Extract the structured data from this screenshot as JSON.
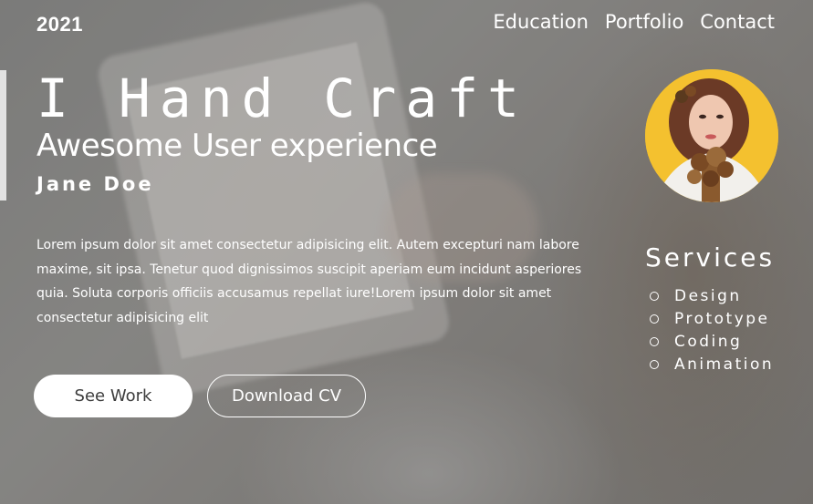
{
  "header": {
    "year": "2021",
    "nav": [
      "Education",
      "Portfolio",
      "Contact"
    ]
  },
  "hero": {
    "headline": "I Hand Craft",
    "subheadline": "Awesome User experience",
    "name": "Jane Doe",
    "bio": "Lorem ipsum dolor sit amet consectetur adipisicing elit. Autem excepturi nam labore maxime, sit ipsa. Tenetur quod dignissimos suscipit aperiam eum incidunt asperiores quia. Soluta corporis officiis accusamus repellat iure!Lorem ipsum dolor sit amet consectetur adipisicing elit"
  },
  "buttons": {
    "primary": "See Work",
    "secondary": "Download CV"
  },
  "services": {
    "title": "Services",
    "items": [
      "Design",
      "Prototype",
      "Coding",
      "Animation"
    ]
  },
  "colors": {
    "avatar_background": "#f4c12f",
    "accent_bar": "#e2e2e2"
  }
}
